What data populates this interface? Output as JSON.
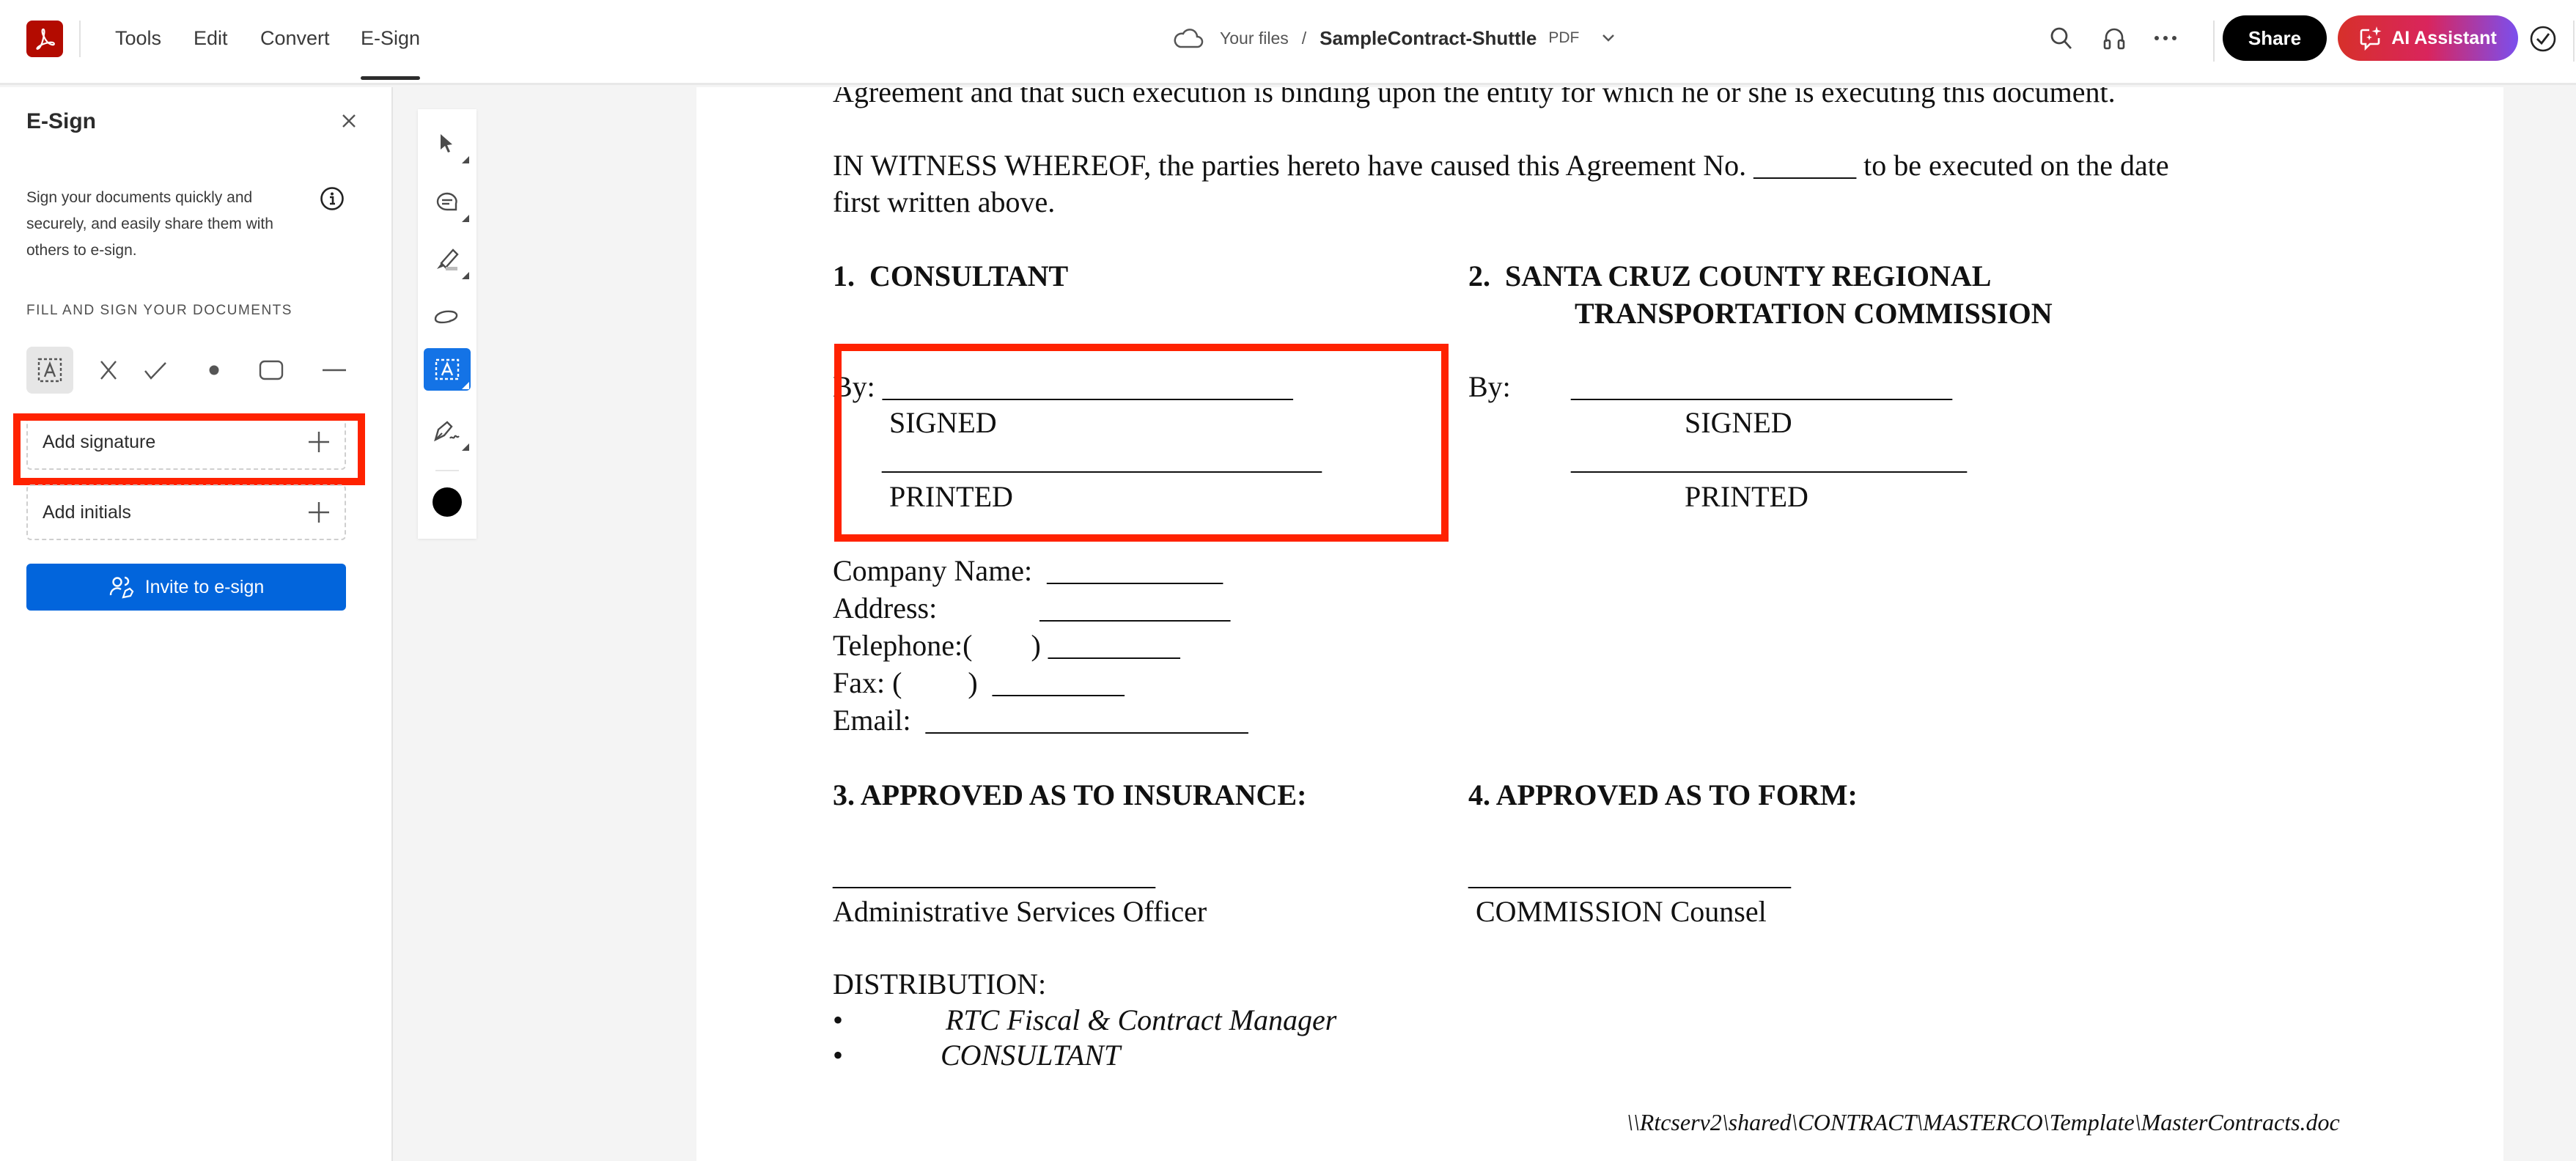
{
  "header": {
    "nav_tabs": [
      {
        "label": "Tools",
        "active": false
      },
      {
        "label": "Edit",
        "active": false
      },
      {
        "label": "Convert",
        "active": false
      },
      {
        "label": "E-Sign",
        "active": true
      }
    ],
    "breadcrumb": {
      "location": "Your files",
      "separator": "/",
      "filename": "SampleContract-Shuttle",
      "filetype": "PDF"
    },
    "icons": [
      "search-icon",
      "headphones-icon",
      "more-icon"
    ],
    "share_label": "Share",
    "ai_assistant_label": "AI Assistant",
    "colors": {
      "brand_red": "#b30b00",
      "ai_gradient_start": "#d7302a",
      "ai_gradient_end": "#7b4fee"
    }
  },
  "panel": {
    "title": "E-Sign",
    "description": "Sign your documents quickly and securely, and easily share them with others to e-sign.",
    "section_label": "FILL AND SIGN YOUR DOCUMENTS",
    "tools": [
      {
        "name": "text-field",
        "selected": true
      },
      {
        "name": "cross-mark",
        "selected": false
      },
      {
        "name": "checkmark",
        "selected": false
      },
      {
        "name": "dot",
        "selected": false
      },
      {
        "name": "rectangle",
        "selected": false
      },
      {
        "name": "line",
        "selected": false
      }
    ],
    "add_signature_label": "Add signature",
    "add_initials_label": "Add initials",
    "invite_label": "Invite to e-sign",
    "accent_color": "#0265dc"
  },
  "vertical_toolbar": {
    "tools": [
      {
        "name": "select",
        "active": false
      },
      {
        "name": "comment",
        "active": false
      },
      {
        "name": "highlight",
        "active": false
      },
      {
        "name": "draw",
        "active": false
      },
      {
        "name": "fill-and-sign",
        "active": true
      },
      {
        "name": "sign",
        "active": false
      }
    ],
    "current_color": "#000000"
  },
  "document": {
    "line_top": "Agreement and that such execution is binding upon the entity for which he or she is executing this document.",
    "witness_line1": "IN WITNESS WHEREOF, the parties hereto have caused this Agreement No. _______ to be executed on the date",
    "witness_line2": "first written above.",
    "consultant": {
      "heading": "1.  CONSULTANT",
      "by_line": "By: ____________________________",
      "signed": "SIGNED",
      "printed_line": "______________________________",
      "printed": "PRINTED"
    },
    "commission": {
      "heading1": "2.  SANTA CRUZ COUNTY REGIONAL",
      "heading2": "TRANSPORTATION COMMISSION",
      "by_label": "By:",
      "by_line": "__________________________",
      "signed": "SIGNED",
      "printed_line": "___________________________",
      "printed": "PRINTED"
    },
    "contact_fields": [
      "Company Name:  ____________",
      "Address:              _____________",
      "Telephone:(        ) _________",
      "Fax: (         )  _________",
      "Email:  ______________________"
    ],
    "approved_insurance": {
      "heading": "3. APPROVED AS TO INSURANCE:",
      "line": "______________________",
      "title": "Administrative Services Officer"
    },
    "approved_form": {
      "heading": "4. APPROVED AS TO FORM:",
      "line": "______________________",
      "title": " COMMISSION Counsel"
    },
    "distribution": {
      "label": "DISTRIBUTION:",
      "items": [
        "RTC Fiscal & Contract Manager",
        "CONSULTANT"
      ]
    },
    "footer_path": "\\\\Rtcserv2\\shared\\CONTRACT\\MASTERCO\\Template\\MasterContracts.doc"
  }
}
